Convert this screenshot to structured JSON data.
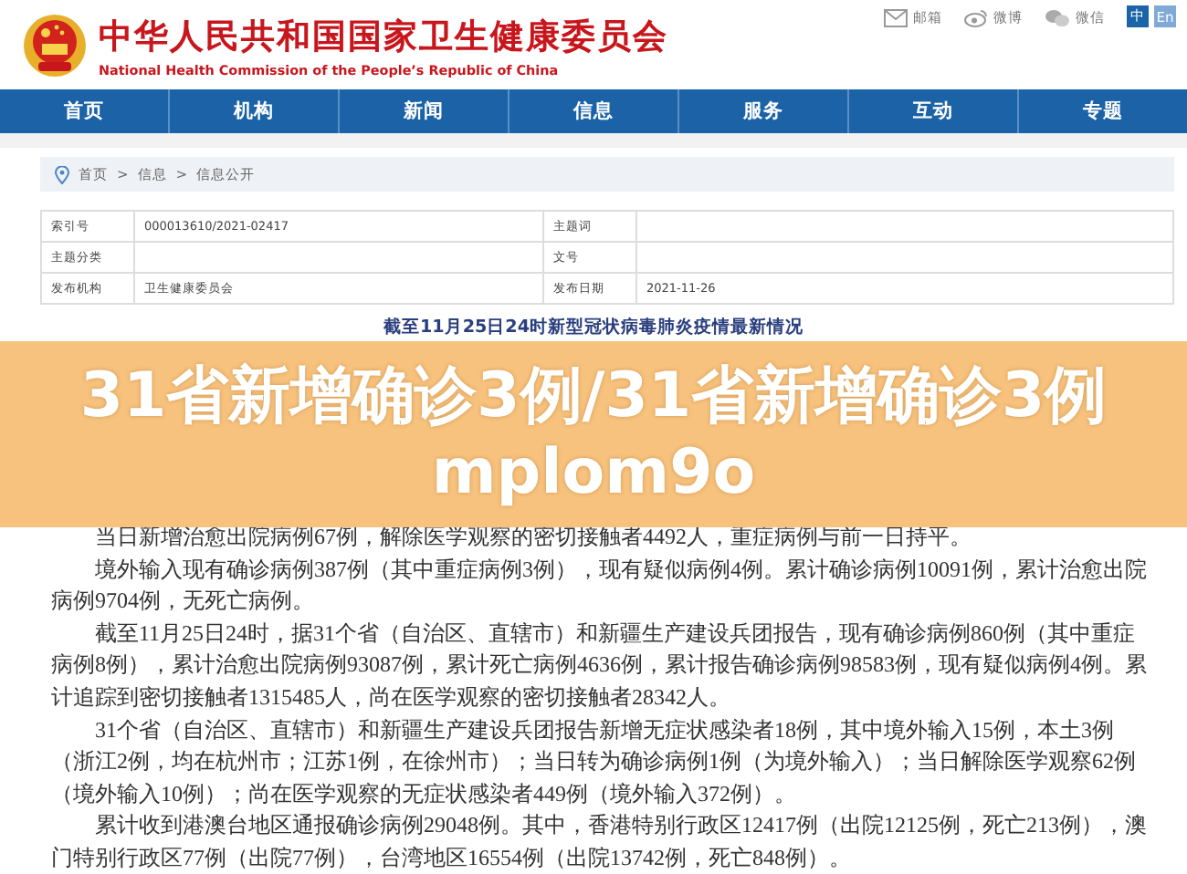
{
  "header": {
    "title": "中华人民共和国国家卫生健康委员会",
    "subtitle": "National Health Commission of the People’s Republic of China",
    "links": [
      {
        "kind": "mail",
        "label": "邮箱"
      },
      {
        "kind": "weibo",
        "label": "微博"
      },
      {
        "kind": "wechat",
        "label": "微信"
      }
    ],
    "languages": [
      {
        "label": "中",
        "selected": true
      },
      {
        "label": "En",
        "selected": false
      }
    ]
  },
  "nav": [
    "首页",
    "机构",
    "新闻",
    "信息",
    "服务",
    "互动",
    "专题"
  ],
  "breadcrumb": [
    {
      "label": "首页"
    },
    {
      "separator": ">",
      "label": "信息"
    },
    {
      "separator": ">",
      "label": "信息公开"
    }
  ],
  "info_table": [
    {
      "label_1": "索引号",
      "value_1": "000013610/2021-02417",
      "label_2": "主题词"
    },
    {
      "label_1": "主题分类",
      "label_2": "文号"
    },
    {
      "label_1": "发布机构",
      "value_1": "卫生健康委员会",
      "label_2": "发布日期",
      "value_2": "2021-11-26"
    }
  ],
  "article": {
    "title": "截至11月25日24时新型冠状病毒肺炎疫情最新情况",
    "paragraphs": [
      "当日新增治愈出院病例67例，解除医学观察的密切接触者4492人，重症病例与前一日持平。",
      "境外输入现有确诊病例387例（其中重症病例3例），现有疑似病例4例。累计确诊病例10091例，累计治愈出院病例9704例，无死亡病例。",
      "截至11月25日24时，据31个省（自治区、直辖市）和新疆生产建设兵团报告，现有确诊病例860例（其中重症病例8例），累计治愈出院病例93087例，累计死亡病例4636例，累计报告确诊病例98583例，现有疑似病例4例。累计追踪到密切接触者1315485人，尚在医学观察的密切接触者28342人。",
      "31个省（自治区、直辖市）和新疆生产建设兵团报告新增无症状感染者18例，其中境外输入15例，本土3例（浙江2例，均在杭州市；江苏1例，在徐州市）；当日转为确诊病例1例（为境外输入）；当日解除医学观察62例（境外输入10例）；尚在医学观察的无症状感染者449例（境外输入372例）。",
      "累计收到港澳台地区通报确诊病例29048例。其中，香港特别行政区12417例（出院12125例，死亡213例），澳门特别行政区77例（出院77例），台湾地区16554例（出院13742例，死亡848例）。"
    ]
  },
  "overlay_banner": {
    "lines": [
      "31省新增确诊3例/31省新增确诊3例",
      "mplom9o"
    ]
  }
}
